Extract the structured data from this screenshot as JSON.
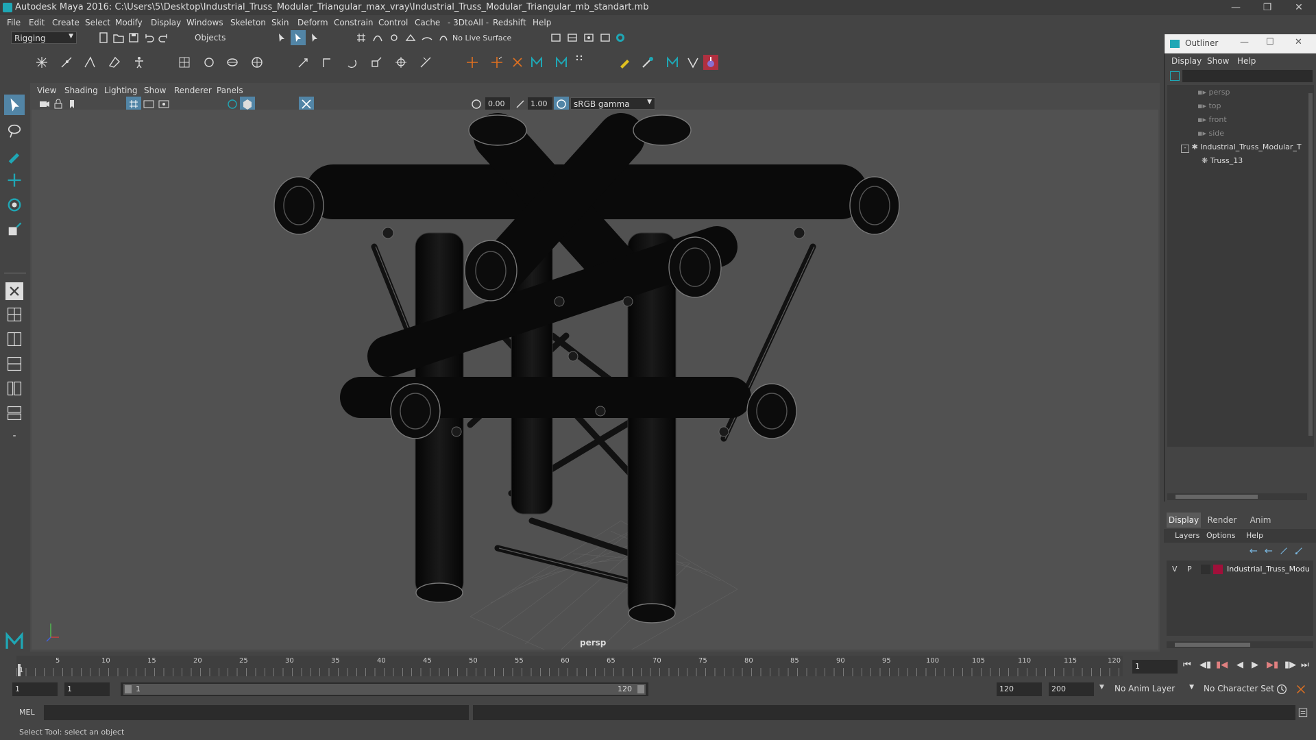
{
  "window": {
    "title": "Autodesk Maya 2016: C:\\Users\\5\\Desktop\\Industrial_Truss_Modular_Triangular_max_vray\\Industrial_Truss_Modular_Triangular_mb_standart.mb"
  },
  "menu": [
    "File",
    "Edit",
    "Create",
    "Select",
    "Modify",
    "Display",
    "Windows",
    "Skeleton",
    "Skin",
    "Deform",
    "Constrain",
    "Control",
    "Cache",
    "- 3DtoAll -",
    "Redshift",
    "Help"
  ],
  "status": {
    "mode": "Rigging",
    "selection_mask": "Objects",
    "live_surface": "No Live Surface"
  },
  "panel_menu": [
    "View",
    "Shading",
    "Lighting",
    "Show",
    "Renderer",
    "Panels"
  ],
  "panel_toolbar": {
    "exposure": "0.00",
    "gamma": "1.00",
    "color_space": "sRGB gamma"
  },
  "viewport": {
    "camera": "persp"
  },
  "outliner": {
    "title": "Outliner",
    "menu": [
      "Display",
      "Show",
      "Help"
    ],
    "items": [
      "persp",
      "top",
      "front",
      "side",
      "Industrial_Truss_Modular_T",
      "Truss_13"
    ]
  },
  "layers": {
    "tabs": [
      "Display",
      "Render",
      "Anim"
    ],
    "menu": [
      "Layers",
      "Options",
      "Help"
    ],
    "row": {
      "v": "V",
      "p": "P",
      "name": "Industrial_Truss_Modu",
      "color": "#a0103a"
    }
  },
  "timeline": {
    "ticks": [
      "5",
      "10",
      "15",
      "20",
      "25",
      "30",
      "35",
      "40",
      "45",
      "50",
      "55",
      "60",
      "65",
      "70",
      "75",
      "80",
      "85",
      "90",
      "95",
      "100",
      "105",
      "110",
      "115",
      "120"
    ],
    "start_tick": "1",
    "current_frame": "1"
  },
  "range": {
    "start": "1",
    "playback_start": "1",
    "slider_start": "1",
    "slider_end": "120",
    "playback_end": "120",
    "end": "200",
    "anim_layer": "No Anim Layer",
    "character_set": "No Character Set"
  },
  "cmd": {
    "label": "MEL"
  },
  "help": {
    "text": "Select Tool: select an object"
  }
}
